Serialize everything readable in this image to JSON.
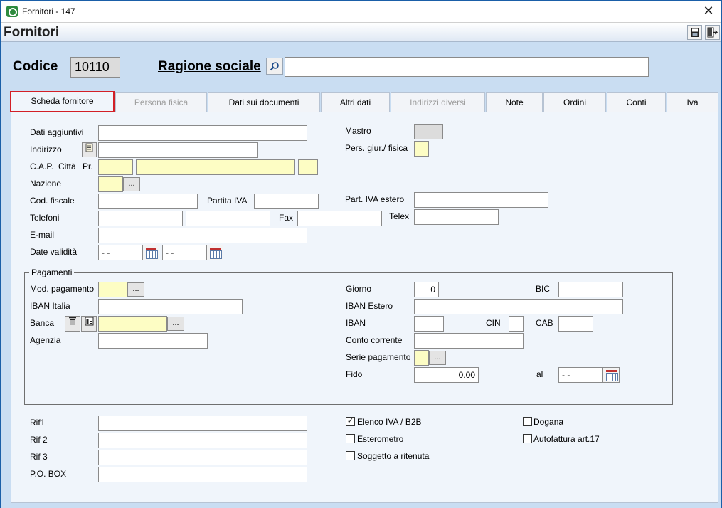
{
  "window": {
    "title": "Fornitori - 147",
    "close_glyph": "✕",
    "icon": "app-q-icon"
  },
  "header": {
    "title": "Fornitori",
    "save_icon": "save-icon",
    "exit_icon": "exit-icon"
  },
  "codice": {
    "label": "Codice",
    "value": "10110"
  },
  "ragione_sociale": {
    "label": "Ragione sociale",
    "value": ""
  },
  "tabs": [
    {
      "label": "Scheda fornitore",
      "state": "active"
    },
    {
      "label": "Persona fisica",
      "state": "disabled"
    },
    {
      "label": "Dati sui documenti",
      "state": "normal"
    },
    {
      "label": "Altri dati",
      "state": "normal"
    },
    {
      "label": "Indirizzi diversi",
      "state": "disabled"
    },
    {
      "label": "Note",
      "state": "normal"
    },
    {
      "label": "Ordini",
      "state": "normal"
    },
    {
      "label": "Conti",
      "state": "normal"
    },
    {
      "label": "Iva",
      "state": "normal"
    }
  ],
  "labels": {
    "dati_aggiuntivi": "Dati aggiuntivi",
    "indirizzo": "Indirizzo",
    "cap": "C.A.P.",
    "citta": "Città",
    "pr": "Pr.",
    "nazione": "Nazione",
    "cod_fiscale": "Cod. fiscale",
    "partita_iva": "Partita IVA",
    "telefoni": "Telefoni",
    "fax": "Fax",
    "telex": "Telex",
    "email": "E-mail",
    "date_validita": "Date validità",
    "mastro": "Mastro",
    "pers_giur": "Pers. giur./ fisica",
    "part_iva_estero": "Part. IVA estero"
  },
  "values": {
    "date_from": "- -",
    "date_to": "- -"
  },
  "pagamenti": {
    "title": "Pagamenti",
    "mod_pagamento": "Mod. pagamento",
    "iban_italia": "IBAN Italia",
    "banca": "Banca",
    "agenzia": "Agenzia",
    "giorno": "Giorno",
    "giorno_value": "0",
    "bic": "BIC",
    "iban_estero": "IBAN Estero",
    "iban": "IBAN",
    "cin": "CIN",
    "cab": "CAB",
    "conto_corrente": "Conto corrente",
    "serie_pagamento": "Serie pagamento",
    "fido": "Fido",
    "fido_value": "0.00",
    "al": "al",
    "al_value": "- -"
  },
  "rif": {
    "rif1": "Rif1",
    "rif2": "Rif 2",
    "rif3": "Rif 3",
    "pobox": "P.O. BOX"
  },
  "checkboxes": [
    {
      "label": "Elenco IVA / B2B",
      "checked": true
    },
    {
      "label": "Esterometro",
      "checked": false
    },
    {
      "label": "Soggetto a ritenuta",
      "checked": false
    },
    {
      "label": "Dogana",
      "checked": false
    },
    {
      "label": "Autofattura art.17",
      "checked": false
    }
  ],
  "ellipsis": "...",
  "search_icon": "search-icon",
  "calendar_icon": "calendar-icon"
}
